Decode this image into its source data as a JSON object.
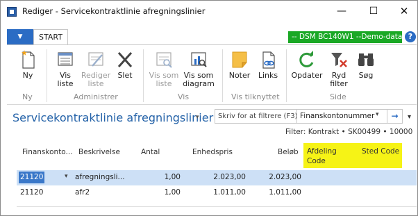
{
  "window": {
    "title": "Rediger - Servicekontraktlinie afregningslinier",
    "minimize": "—",
    "maximize": "☐",
    "close": "✕"
  },
  "ribbon_tabs": {
    "file_glyph": "▼",
    "start": "START",
    "environment": "-- DSM BC140W1 --Demo-data",
    "help": "?"
  },
  "ribbon": {
    "groups": [
      {
        "label": "Ny",
        "buttons": [
          {
            "label": "Ny",
            "icon": "new-document-icon"
          }
        ]
      },
      {
        "label": "Administrer",
        "buttons": [
          {
            "label": "Vis\nliste",
            "icon": "view-list-icon"
          },
          {
            "label": "Rediger\nliste",
            "icon": "edit-list-icon",
            "disabled": true
          },
          {
            "label": "Slet",
            "icon": "delete-x-icon"
          }
        ]
      },
      {
        "label": "Vis",
        "buttons": [
          {
            "label": "Vis som\nliste",
            "icon": "view-as-list-icon",
            "disabled": true
          },
          {
            "label": "Vis som\ndiagram",
            "icon": "view-as-chart-icon"
          }
        ]
      },
      {
        "label": "Vis tilknyttet",
        "buttons": [
          {
            "label": "Noter",
            "icon": "notes-icon"
          },
          {
            "label": "Links",
            "icon": "links-icon"
          }
        ]
      },
      {
        "label": "Side",
        "buttons": [
          {
            "label": "Opdater",
            "icon": "refresh-icon"
          },
          {
            "label": "Ryd\nfilter",
            "icon": "clear-filter-icon"
          },
          {
            "label": "Søg",
            "icon": "binoculars-icon"
          }
        ]
      }
    ]
  },
  "page": {
    "title": "Servicekontraktlinie afregningslinier",
    "title_caret": "▾",
    "search_placeholder": "Skriv for at filtrere (F3)",
    "search_field": "Finanskontonummer",
    "search_dropdown": "▾",
    "search_go": "→",
    "expand": "▾",
    "filter_summary": "Filter: Kontrakt • SK00499 • 10000"
  },
  "grid": {
    "columns": {
      "account": "Finanskonto...",
      "description": "Beskrivelse",
      "quantity": "Antal",
      "unit_price": "Enhedspris",
      "amount": "Beløb",
      "department": "Afdeling\nCode",
      "location": "Sted Code"
    },
    "rows": [
      {
        "account": "21120",
        "description": "afregningsli...",
        "quantity": "1,00",
        "unit_price": "2.023,00",
        "amount": "2.023,00",
        "selected": true
      },
      {
        "account": "21120",
        "description": "afr2",
        "quantity": "1,00",
        "unit_price": "1.011,00",
        "amount": "1.011,00",
        "selected": false
      }
    ],
    "row_caret": "▾"
  },
  "colors": {
    "accent_blue": "#2b6cc4",
    "title_blue": "#2462a8",
    "env_green": "#1aa825",
    "highlight_yellow": "#f6f316",
    "selected_row": "#cde0f6"
  }
}
